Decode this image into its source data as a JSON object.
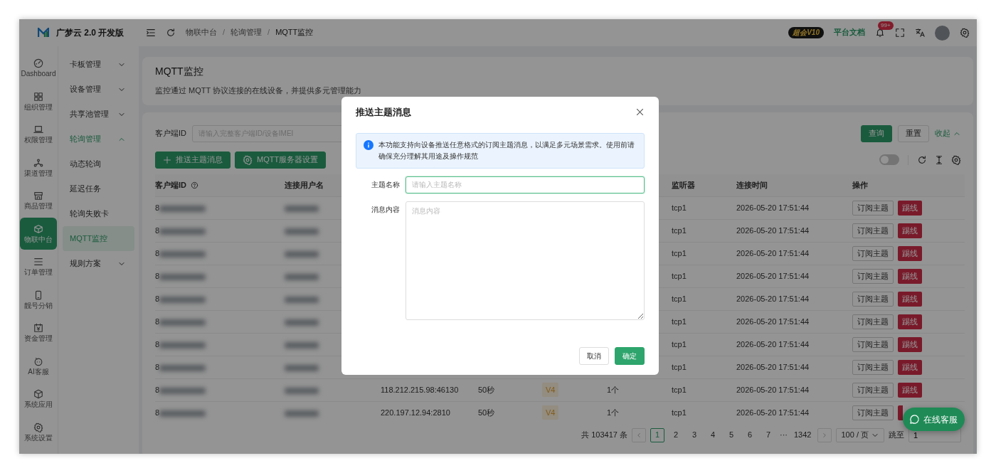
{
  "app": {
    "logo_text": "广梦云 2.0 开发版"
  },
  "rail": [
    {
      "label": "Dashboard",
      "selected": false
    },
    {
      "label": "组织管理",
      "selected": false
    },
    {
      "label": "权限管理",
      "selected": false
    },
    {
      "label": "渠道管理",
      "selected": false
    },
    {
      "label": "商品管理",
      "selected": false
    },
    {
      "label": "物联中台",
      "selected": true
    },
    {
      "label": "订单管理",
      "selected": false
    },
    {
      "label": "靓号分销",
      "selected": false
    },
    {
      "label": "资金管理",
      "selected": false
    },
    {
      "label": "AI客服",
      "selected": false
    },
    {
      "label": "系统应用",
      "selected": false
    },
    {
      "label": "系统设置",
      "selected": false
    }
  ],
  "submenu": [
    {
      "label": "卡板管理",
      "selected": false,
      "expanded": false
    },
    {
      "label": "设备管理",
      "selected": false,
      "expanded": false
    },
    {
      "label": "共享池管理",
      "selected": false,
      "expanded": false
    },
    {
      "label": "轮询管理",
      "selected": true,
      "expanded": true,
      "children": [
        {
          "label": "动态轮询",
          "selected": false
        },
        {
          "label": "延迟任务",
          "selected": false
        },
        {
          "label": "轮询失败卡",
          "selected": false
        },
        {
          "label": "MQTT监控",
          "selected": true
        }
      ]
    },
    {
      "label": "规则方案",
      "selected": false,
      "expanded": false
    }
  ],
  "topbar": {
    "breadcrumb": [
      {
        "label": "物联中台"
      },
      {
        "separator": "/",
        "label": "轮询管理"
      },
      {
        "separator": "/",
        "label": "MQTT监控"
      }
    ],
    "vip_badge": "超会V10",
    "docs_link": "平台文档",
    "notification_count": "99+"
  },
  "page": {
    "title": "MQTT监控",
    "description": "监控通过 MQTT 协议连接的在线设备，并提供多元管理能力"
  },
  "filters": {
    "label": "客户端ID",
    "placeholder": "请输入完整客户端ID/设备IMEI",
    "query": "查询",
    "reset": "重置",
    "collapse": "收起"
  },
  "actions": [
    {
      "label": "推送主题消息",
      "kind": "plus"
    },
    {
      "label": "MQTT服务器设置",
      "kind": "gear"
    }
  ],
  "toolbar": {
    "on": false
  },
  "table": {
    "columns": [
      {
        "label": "客户端ID",
        "help": true
      },
      {
        "label": "连接用户名"
      },
      {
        "label": "监听器"
      },
      {
        "label": "连接时间"
      },
      {
        "label": "操作"
      }
    ],
    "rows": [
      {
        "client_id": "8",
        "listener": "tcp1",
        "time": "2026-05-20 17:51:44",
        "actions": [
          "订阅主题",
          "踢线"
        ]
      },
      {
        "client_id": "8",
        "listener": "tcp1",
        "time": "2026-05-20 17:51:44",
        "actions": [
          "订阅主题",
          "踢线"
        ]
      },
      {
        "client_id": "8",
        "listener": "tcp1",
        "time": "2026-05-20 17:51:44",
        "actions": [
          "订阅主题",
          "踢线"
        ]
      },
      {
        "client_id": "8",
        "listener": "tcp1",
        "time": "2026-05-20 17:51:44",
        "actions": [
          "订阅主题",
          "踢线"
        ]
      },
      {
        "client_id": "8",
        "listener": "tcp1",
        "time": "2026-05-20 17:51:44",
        "actions": [
          "订阅主题",
          "踢线"
        ]
      },
      {
        "client_id": "8",
        "listener": "tcp1",
        "time": "2026-05-20 17:51:44",
        "actions": [
          "订阅主题",
          "踢线"
        ]
      },
      {
        "client_id": "8",
        "listener": "tcp1",
        "time": "2026-05-20 17:51:44",
        "actions": [
          "订阅主题",
          "踢线"
        ]
      },
      {
        "client_id": "8",
        "listener": "tcp1",
        "time": "2026-05-20 17:51:44",
        "actions": [
          "订阅主题",
          "踢线"
        ]
      },
      {
        "client_id": "8",
        "address": "118.212.215.98:46130",
        "keepalive": "50秒",
        "protocol": "V4",
        "subscriptions": "1个",
        "listener": "tcp1",
        "time": "2026-05-20 17:51:44",
        "actions": [
          "订阅主题",
          "踢线"
        ]
      },
      {
        "client_id": "8",
        "address": "220.197.12.94:2810",
        "keepalive": "50秒",
        "protocol": "V4",
        "subscriptions": "1个",
        "listener": "tcp1",
        "time": "2026-05-20 17:51:44",
        "actions": [
          "订阅主题"
        ],
        "kick_covered": true
      }
    ]
  },
  "pagination": {
    "total": "共 103417 条",
    "pages": [
      {
        "label": "1",
        "selected": true
      },
      {
        "label": "2",
        "selected": false
      },
      {
        "label": "3",
        "selected": false
      },
      {
        "label": "4",
        "selected": false
      },
      {
        "label": "5",
        "selected": false
      },
      {
        "label": "6",
        "selected": false
      },
      {
        "label": "7",
        "selected": false
      }
    ],
    "ellipsis": "···",
    "last_page": "1342",
    "page_size": "100 / 页",
    "jump_label": "跳至",
    "jump_value": "1"
  },
  "chat": {
    "label": "在线客服"
  },
  "modal": {
    "title": "推送主题消息",
    "info": "本功能支持向设备推送任意格式的订阅主题消息，以满足多元场景需求。使用前请确保充分理解其用途及操作规范",
    "fields": [
      {
        "label": "主题名称",
        "placeholder": "请输入主题名称",
        "kind": "input",
        "focused": true
      },
      {
        "label": "消息内容",
        "placeholder": "消息内容",
        "kind": "textarea",
        "focused": false
      }
    ],
    "cancel": "取消",
    "ok": "确定"
  }
}
